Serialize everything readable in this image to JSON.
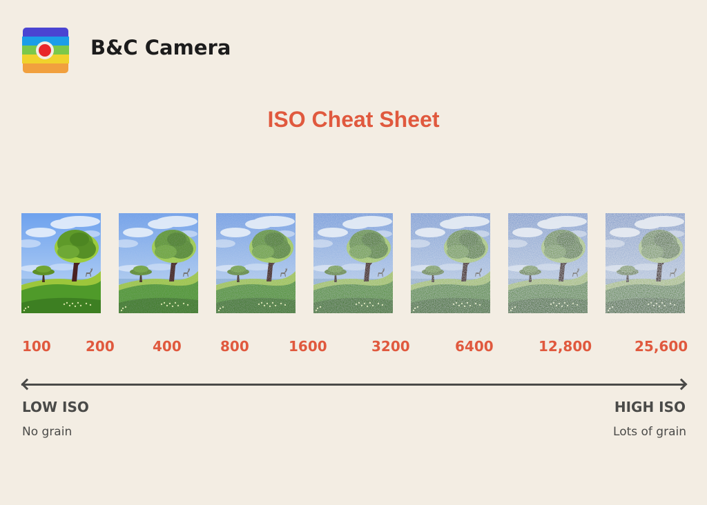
{
  "brand": {
    "name": "B&C Camera",
    "logo_colors": {
      "stripe1": "#4a44d2",
      "stripe2": "#1c9de8",
      "stripe3": "#7bc84a",
      "stripe4": "#f0d22c",
      "stripe5": "#f1a03e",
      "lens": "#e8262a"
    }
  },
  "title": "ISO Cheat Sheet",
  "colors": {
    "accent": "#e0593e",
    "text_dark": "#4a4a48",
    "background": "#f3ede3"
  },
  "photos": [
    {
      "iso": "100",
      "noise": 0.0,
      "desaturation": 0.0
    },
    {
      "iso": "400",
      "noise": 0.12,
      "desaturation": 0.08
    },
    {
      "iso": "1600",
      "noise": 0.25,
      "desaturation": 0.16
    },
    {
      "iso": "3200",
      "noise": 0.4,
      "desaturation": 0.26
    },
    {
      "iso": "6400",
      "noise": 0.55,
      "desaturation": 0.36
    },
    {
      "iso": "12,800",
      "noise": 0.7,
      "desaturation": 0.44
    },
    {
      "iso": "25,600",
      "noise": 0.85,
      "desaturation": 0.5
    }
  ],
  "iso_values": [
    "100",
    "200",
    "400",
    "800",
    "1600",
    "3200",
    "6400",
    "12,800",
    "25,600"
  ],
  "scale": {
    "low_label": "LOW ISO",
    "low_desc": "No grain",
    "high_label": "HIGH ISO",
    "high_desc": "Lots of grain"
  }
}
